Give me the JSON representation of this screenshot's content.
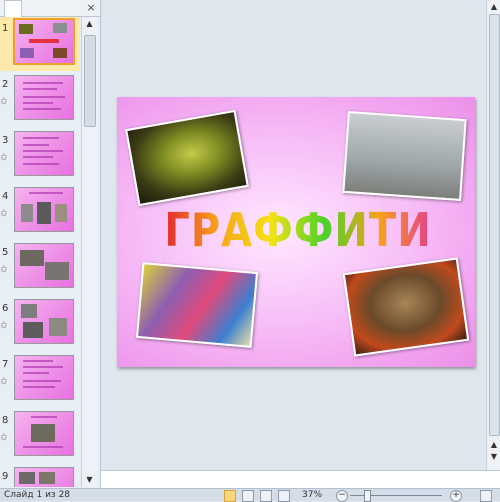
{
  "panel": {
    "close_glyph": "×",
    "thumbnails": [
      {
        "number": "1",
        "star": ""
      },
      {
        "number": "2",
        "star": "✩"
      },
      {
        "number": "3",
        "star": "✩"
      },
      {
        "number": "4",
        "star": "✩"
      },
      {
        "number": "5",
        "star": "✩"
      },
      {
        "number": "6",
        "star": "✩"
      },
      {
        "number": "7",
        "star": "✩"
      },
      {
        "number": "8",
        "star": "✩"
      },
      {
        "number": "9",
        "star": ""
      }
    ],
    "selected_index": 0
  },
  "slide": {
    "title": "ГРАФФИТИ"
  },
  "status_bar": {
    "slide_info": "Слайд 1 из 28",
    "zoom": "37%",
    "zoom_minus": "−",
    "zoom_plus": "+"
  },
  "colors": {
    "slide_pink": "#f6b8f6",
    "selection": "#fde9a9",
    "accent_orange": "#f0a030"
  },
  "icons": [
    "slides-tab-icon",
    "outline-tab-icon",
    "close-icon",
    "scroll-up-icon",
    "scroll-down-icon",
    "normal-view-icon",
    "slide-sorter-icon",
    "reading-view-icon",
    "slideshow-icon",
    "fit-window-icon"
  ]
}
